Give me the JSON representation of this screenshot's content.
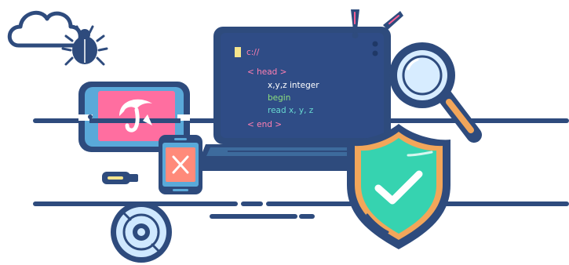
{
  "colors": {
    "navy": "#2c4a7a",
    "outline": "#2e4b7d",
    "screen": "#2f4c86",
    "tablet_screen": "#ff6ea0",
    "tablet_frame": "#5aa9d9",
    "phone_screen": "#ff8a7a",
    "shield_green": "#36d3b0",
    "shield_orange": "#f2a65a",
    "yellow": "#f6e58d",
    "code_pink": "#ff7fb2",
    "code_white": "#ffffff",
    "code_green": "#8ee07d",
    "code_teal": "#68d8d0",
    "lens_blue": "#d7ecff",
    "disc_blue": "#cfe8ff",
    "alert_pink": "#ff5f95"
  },
  "icons": {
    "cloud": "cloud-icon",
    "bug": "bug-icon",
    "tablet": "tablet-icon",
    "tablet_symbol": "umbrella-logo-icon",
    "phone": "phone-icon",
    "phone_symbol": "close-icon",
    "laptop": "laptop-icon",
    "shield": "shield-check-icon",
    "magnifier": "magnifier-icon",
    "disc": "disc-icon",
    "usb": "usb-icon"
  },
  "code": {
    "prompt": "c://",
    "line1": "< head >",
    "line2": "x,y,z integer",
    "line3": "begin",
    "line4": "read x, y, z",
    "line5": "< end >"
  }
}
